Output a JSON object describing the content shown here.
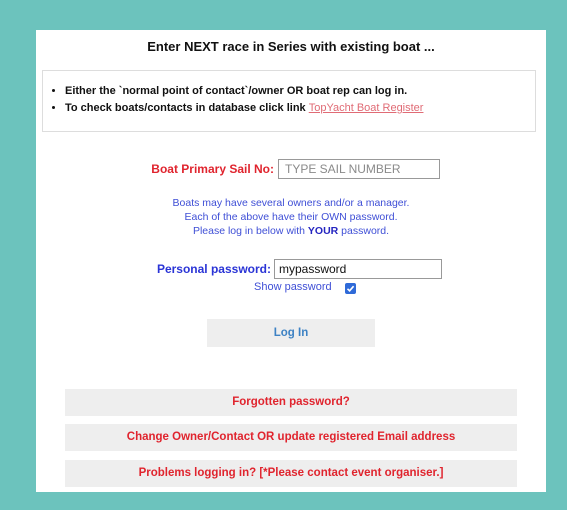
{
  "header": {
    "title": "Enter NEXT race in Series with existing boat ..."
  },
  "info": {
    "bullet1": "Either the `normal point of contact`/owner OR boat rep can log in.",
    "bullet2_prefix": "To check boats/contacts in database click link ",
    "bullet2_link": "TopYacht Boat Register"
  },
  "sail": {
    "label": "Boat Primary Sail No:",
    "placeholder": "TYPE SAIL NUMBER"
  },
  "help": {
    "line1": "Boats may have several owners and/or a manager.",
    "line2": "Each of the above have their OWN password.",
    "line3_prefix": "Please log in below with ",
    "line3_bold": "YOUR",
    "line3_suffix": " password."
  },
  "password": {
    "label": "Personal password:",
    "value": "mypassword",
    "show_label": "Show password",
    "show_checked": true
  },
  "login": {
    "label": "Log In"
  },
  "actions": {
    "forgot": "Forgotten password?",
    "change": "Change Owner/Contact OR update registered Email address",
    "problems": "Problems logging in?   [*Please contact event organiser.]"
  },
  "colors": {
    "background": "#6cc3bd",
    "accent_red": "#e0242e",
    "accent_blue": "#2a34d6",
    "link": "#e06b75"
  }
}
